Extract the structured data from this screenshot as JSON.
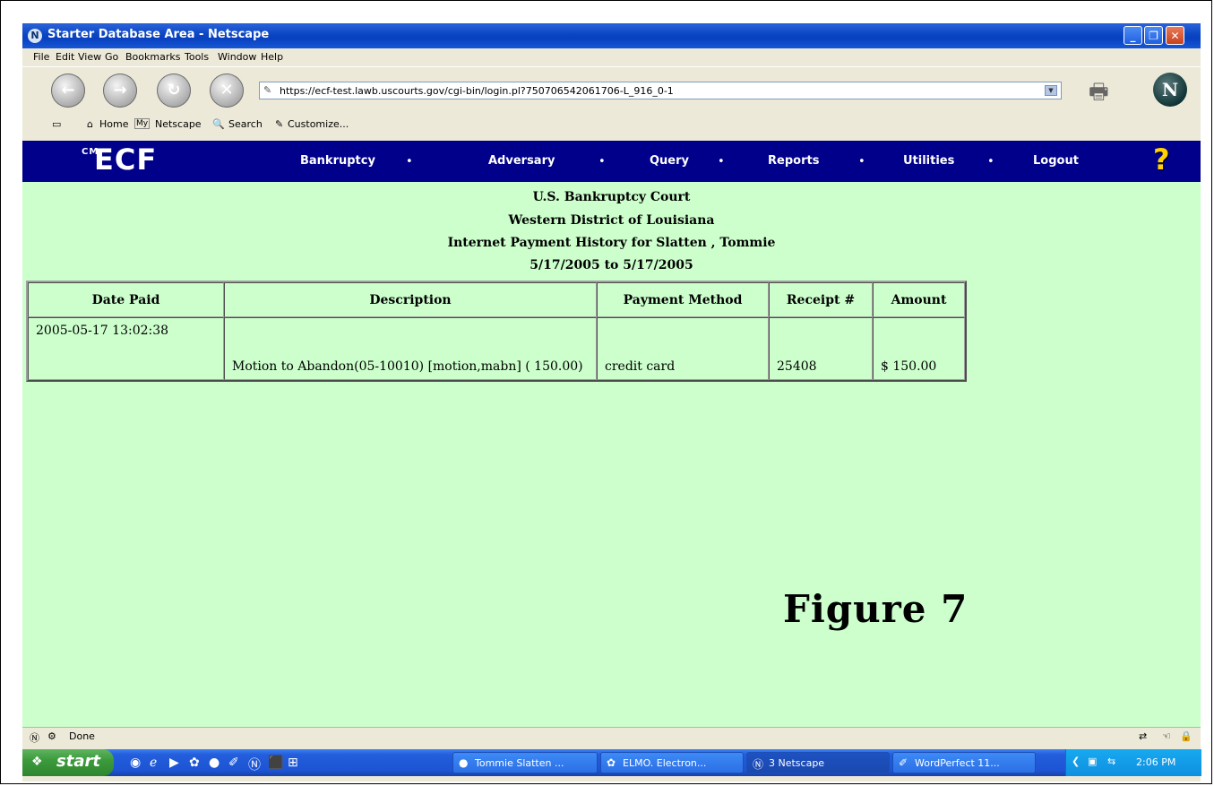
{
  "window": {
    "title": "Starter Database Area - Netscape"
  },
  "menubar": {
    "items": [
      "File",
      "Edit",
      "View",
      "Go",
      "Bookmarks",
      "Tools",
      "Window",
      "Help"
    ]
  },
  "navbar": {
    "url": "https://ecf-test.lawb.uscourts.gov/cgi-bin/login.pl?750706542061706-L_916_0-1"
  },
  "personal_toolbar": {
    "home": "Home",
    "my_netscape": "Netscape",
    "my_badge": "My",
    "search": "Search",
    "customize": "Customize..."
  },
  "ecf": {
    "logo": "ECF",
    "logo_prefix": "CM",
    "menu": [
      "Bankruptcy",
      "Adversary",
      "Query",
      "Reports",
      "Utilities",
      "Logout"
    ]
  },
  "content": {
    "header_lines": [
      "U.S. Bankruptcy Court",
      "Western District of Louisiana",
      "Internet Payment History for Slatten , Tommie",
      "5/17/2005 to 5/17/2005"
    ],
    "table": {
      "columns": [
        "Date Paid",
        "Description",
        "Payment Method",
        "Receipt #",
        "Amount"
      ],
      "rows": [
        [
          "2005-05-17 13:02:38",
          "Motion to Abandon(05-10010) [motion,mabn] ( 150.00)",
          "credit card",
          "25408",
          "$ 150.00"
        ]
      ]
    },
    "figure_caption": "Figure 7"
  },
  "status": {
    "text": "Done"
  },
  "taskbar": {
    "start": "start",
    "buttons": [
      "Tommie Slatten ...",
      "ELMO. Electron...",
      "3 Netscape",
      "WordPerfect 11..."
    ],
    "clock": "2:06 PM"
  }
}
